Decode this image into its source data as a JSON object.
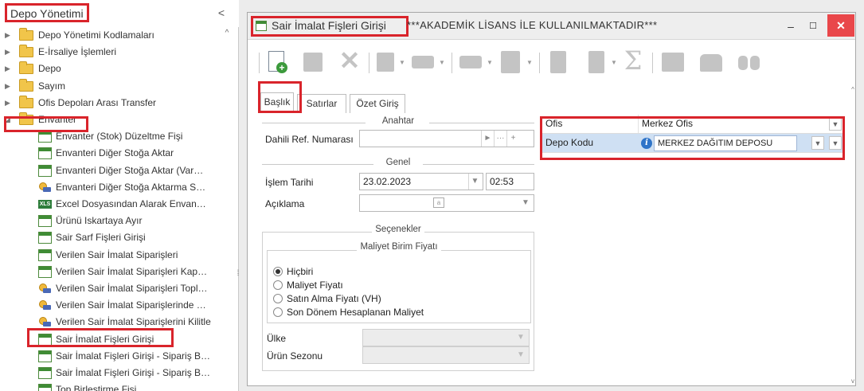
{
  "left_panel": {
    "title": "Depo Yönetimi",
    "collapse_glyph": "<",
    "scroll_up_glyph": "^",
    "tree": [
      {
        "label": "Depo Yönetimi Kodlamaları",
        "type": "folder",
        "level": 0,
        "expanded": false
      },
      {
        "label": "E-İrsaliye İşlemleri",
        "type": "folder",
        "level": 0,
        "expanded": false
      },
      {
        "label": "Depo",
        "type": "folder",
        "level": 0,
        "expanded": false
      },
      {
        "label": "Sayım",
        "type": "folder",
        "level": 0,
        "expanded": false
      },
      {
        "label": "Ofis Depoları Arası Transfer",
        "type": "folder",
        "level": 0,
        "expanded": false
      },
      {
        "label": "Envanter",
        "type": "folder",
        "level": 0,
        "expanded": true
      },
      {
        "label": "Envanter (Stok) Düzeltme Fişi",
        "type": "doc",
        "level": 1
      },
      {
        "label": "Envanteri Diğer Stoğa Aktar",
        "type": "doc",
        "level": 1
      },
      {
        "label": "Envanteri Diğer Stoğa Aktar (Var…",
        "type": "doc",
        "level": 1
      },
      {
        "label": "Envanteri Diğer Stoğa Aktarma S…",
        "type": "key",
        "level": 1
      },
      {
        "label": "Excel Dosyasından Alarak Envan…",
        "type": "excel",
        "level": 1
      },
      {
        "label": "Ürünü Iskartaya Ayır",
        "type": "doc",
        "level": 1
      },
      {
        "label": "Sair Sarf Fişleri Girişi",
        "type": "doc",
        "level": 1
      },
      {
        "label": "Verilen Sair İmalat Siparişleri",
        "type": "doc",
        "level": 1
      },
      {
        "label": "Verilen Sair İmalat Siparişleri Kap…",
        "type": "doc",
        "level": 1
      },
      {
        "label": "Verilen Sair İmalat Siparişleri Topl…",
        "type": "key",
        "level": 1
      },
      {
        "label": "Verilen Sair İmalat Siparişlerinde …",
        "type": "key",
        "level": 1
      },
      {
        "label": "Verilen Sair İmalat Siparişlerini Kilitle",
        "type": "key",
        "level": 1
      },
      {
        "label": "Sair İmalat Fişleri Girişi",
        "type": "doc",
        "level": 1
      },
      {
        "label": "Sair İmalat Fişleri Girişi - Sipariş B…",
        "type": "doc",
        "level": 1
      },
      {
        "label": "Sair İmalat Fişleri Girişi - Sipariş B…",
        "type": "doc",
        "level": 1
      },
      {
        "label": "Top Birleştirme Fişi",
        "type": "doc",
        "level": 1
      }
    ]
  },
  "window": {
    "title": "Sair İmalat Fişleri Girişi",
    "subtitle": "***AKADEMİK LİSANS İLE KULLANILMAKTADIR***",
    "minimize_glyph": "–",
    "maximize_glyph": "☐",
    "close_glyph": "✕"
  },
  "tabs": [
    {
      "label": "Başlık",
      "active": true
    },
    {
      "label": "Satırlar",
      "active": false
    },
    {
      "label": "Özet Giriş",
      "active": false
    }
  ],
  "form": {
    "section_key": "Anahtar",
    "ref_label": "Dahili Ref. Numarası",
    "ref_value": "",
    "section_general": "Genel",
    "date_label": "İşlem Tarihi",
    "date_value": "23.02.2023",
    "time_value": "02:53",
    "desc_label": "Açıklama",
    "desc_value": "",
    "section_options": "Seçenekler",
    "section_cost": "Maliyet Birim Fiyatı",
    "radios": [
      {
        "label": "Hiçbiri",
        "checked": true
      },
      {
        "label": "Maliyet Fiyatı",
        "checked": false
      },
      {
        "label": "Satın Alma Fiyatı (VH)",
        "checked": false
      },
      {
        "label": "Son Dönem Hesaplanan Maliyet",
        "checked": false
      }
    ],
    "country_label": "Ülke",
    "country_value": "",
    "season_label": "Ürün Sezonu",
    "season_value": ""
  },
  "grid": {
    "office_label": "Ofis",
    "office_value": "Merkez Ofis",
    "depot_label": "Depo Kodu",
    "depot_value": "MERKEZ DAĞITIM DEPOSU"
  },
  "colors": {
    "highlight_red": "#d9242b",
    "selected_row": "#cfe0f3",
    "close_button": "#e9474a",
    "folder_yellow": "#f1c54a",
    "doc_green": "#3f8c35"
  }
}
